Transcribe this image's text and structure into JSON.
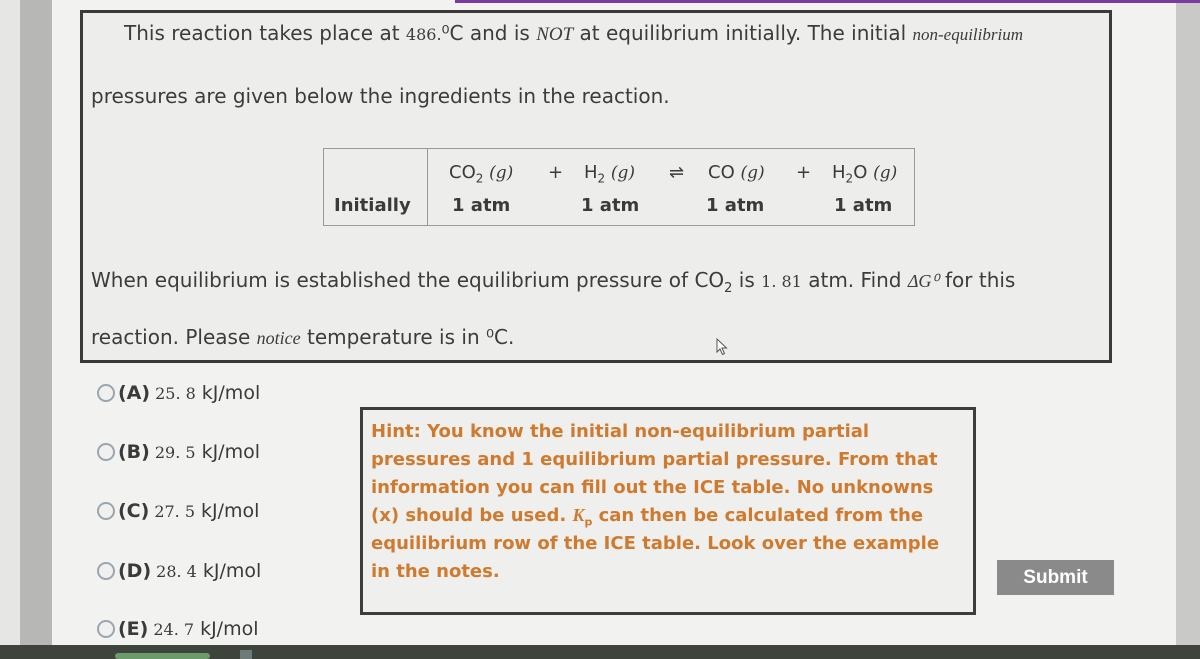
{
  "question": {
    "line1": {
      "p1": "This reaction takes place at",
      "temperature": "486.",
      "deg_unit": "⁰C and is",
      "not": "NOT",
      "p2": "at equilibrium initially.  The initial",
      "noneq": "non-equilibrium"
    },
    "line2": "pressures are given below the ingredients in the reaction.",
    "line3": {
      "p1": "When equilibrium is established the equilibrium pressure of CO",
      "sub": "2",
      "p2": "is",
      "value": "1. 81",
      "p3": "atm.  Find",
      "dg": "ΔG⁰",
      "p4": "for this"
    },
    "line4": {
      "p1": "reaction. Please",
      "notice": "notice",
      "p2": "temperature is in ⁰C."
    }
  },
  "reaction_table": {
    "row_label": "Initially",
    "plus": "+",
    "equilibrium_arrow": "⇌",
    "species": [
      {
        "formula": "CO",
        "sub": "2",
        "phase": "(g)",
        "initial": "1 atm"
      },
      {
        "formula": "H",
        "sub": "2",
        "phase": "(g)",
        "initial": "1 atm"
      },
      {
        "formula": "CO",
        "sub": "",
        "phase": "(g)",
        "initial": "1 atm"
      },
      {
        "formula": "H",
        "sub": "2",
        "formula_tail": "O",
        "phase": "(g)",
        "initial": "1 atm"
      }
    ]
  },
  "options": [
    {
      "letter": "(A)",
      "value": "25. 8",
      "unit": "kJ/mol",
      "selected": false
    },
    {
      "letter": "(B)",
      "value": "29. 5",
      "unit": "kJ/mol",
      "selected": false
    },
    {
      "letter": "(C)",
      "value": "27. 5",
      "unit": "kJ/mol",
      "selected": false
    },
    {
      "letter": "(D)",
      "value": "28. 4",
      "unit": "kJ/mol",
      "selected": false
    },
    {
      "letter": "(E)",
      "value": "24. 7",
      "unit": "kJ/mol",
      "selected": false
    }
  ],
  "hint": {
    "lines": [
      "Hint:  You know the initial non-equilibrium partial",
      "pressures and 1 equilibrium partial pressure.  From that",
      "information you can fill out the ICE table.  No unknowns"
    ],
    "line4_pre": "(x) should be used.  ",
    "kp": "K",
    "kp_sub": "p",
    "line4_post": " can then be calculated from the",
    "line5": "equilibrium row of the ICE table.  Look over the example",
    "line6": "in the notes.",
    "color": "#cf7a2e"
  },
  "submit": {
    "label": "Submit"
  },
  "colors": {
    "top_accent": "#7a3aa0",
    "submit_bg": "#8a8a8a"
  }
}
